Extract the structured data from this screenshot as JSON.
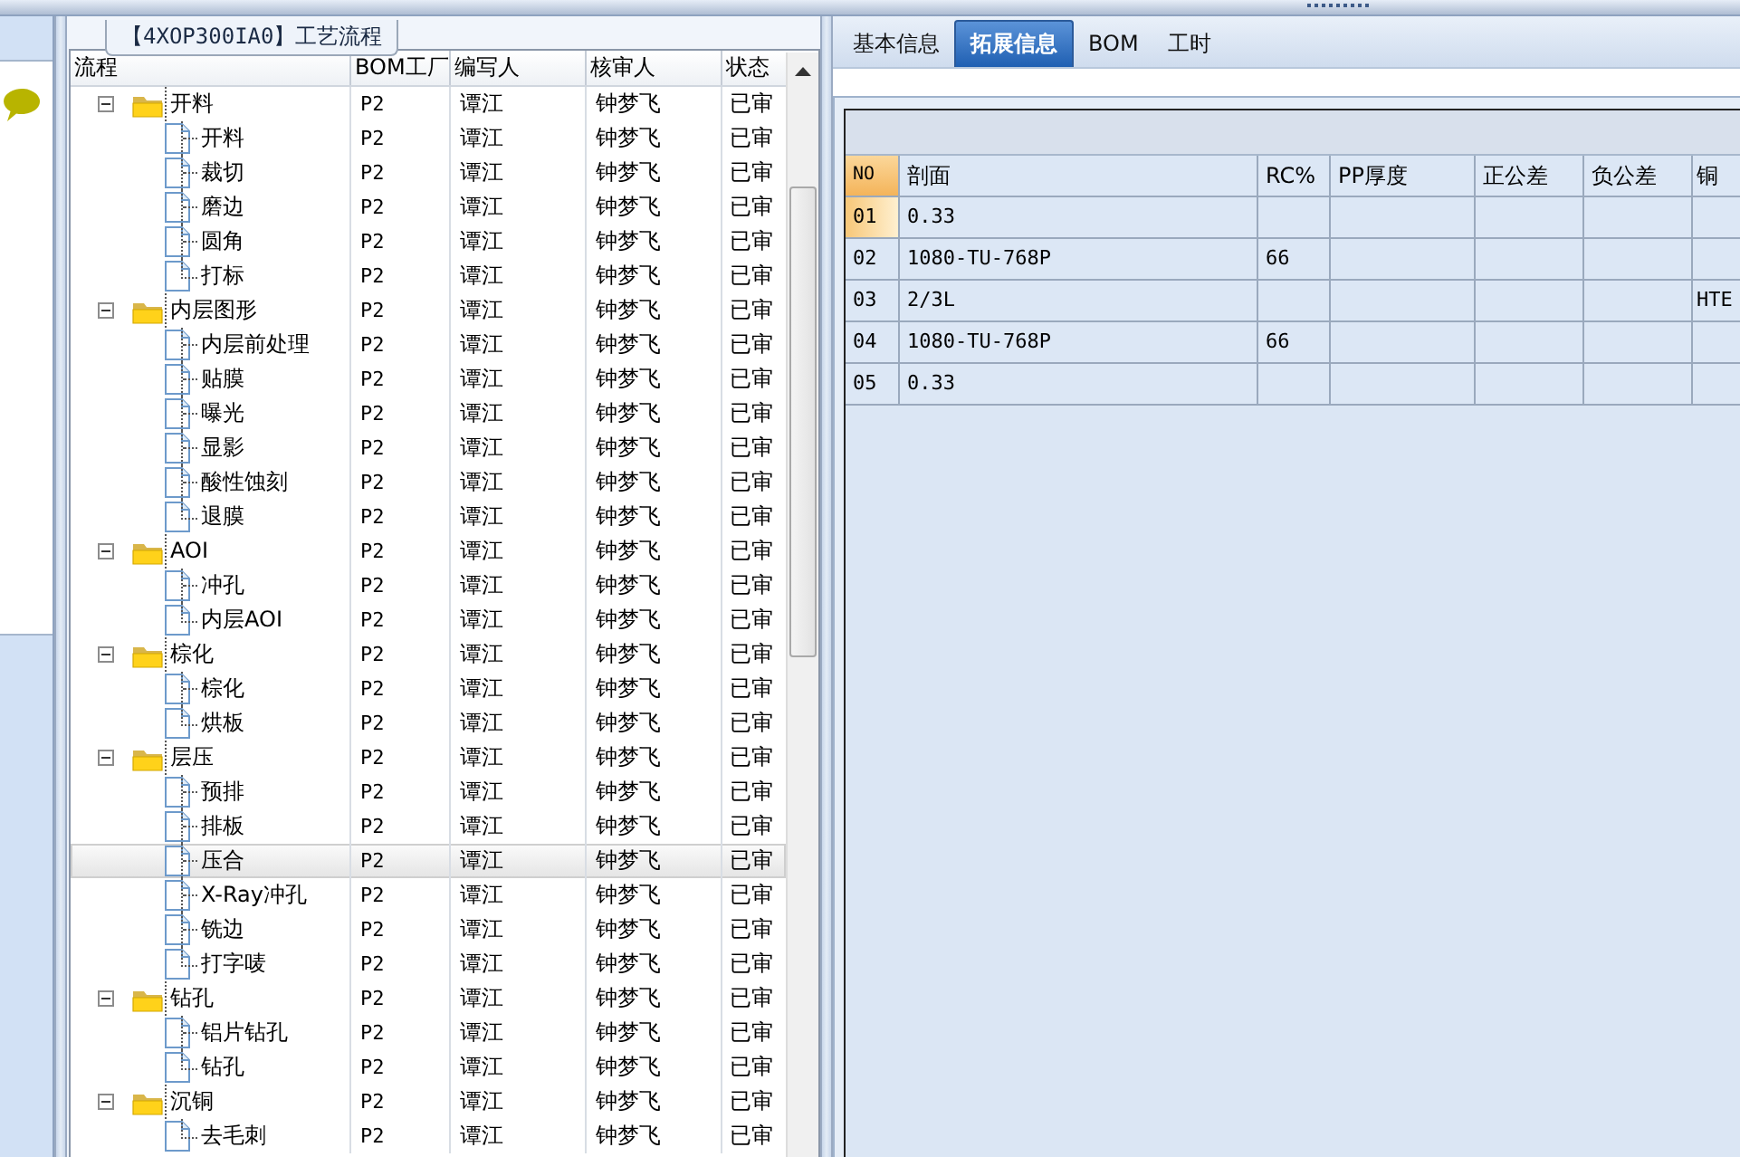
{
  "process_panel": {
    "title": "【4XOP300IA0】工艺流程",
    "columns": [
      "流程",
      "BOM工厂",
      "编写人",
      "核审人",
      "状态"
    ],
    "tree": [
      {
        "name": "开料",
        "bom": "P2",
        "writer": "谭江",
        "reviewer": "钟梦飞",
        "status": "已审",
        "expanded": true,
        "selected": false,
        "children": [
          {
            "name": "开料",
            "bom": "P2",
            "writer": "谭江",
            "reviewer": "钟梦飞",
            "status": "已审",
            "selected": false
          },
          {
            "name": "裁切",
            "bom": "P2",
            "writer": "谭江",
            "reviewer": "钟梦飞",
            "status": "已审",
            "selected": false
          },
          {
            "name": "磨边",
            "bom": "P2",
            "writer": "谭江",
            "reviewer": "钟梦飞",
            "status": "已审",
            "selected": false
          },
          {
            "name": "圆角",
            "bom": "P2",
            "writer": "谭江",
            "reviewer": "钟梦飞",
            "status": "已审",
            "selected": false
          },
          {
            "name": "打标",
            "bom": "P2",
            "writer": "谭江",
            "reviewer": "钟梦飞",
            "status": "已审",
            "selected": false
          }
        ]
      },
      {
        "name": "内层图形",
        "bom": "P2",
        "writer": "谭江",
        "reviewer": "钟梦飞",
        "status": "已审",
        "expanded": true,
        "selected": false,
        "children": [
          {
            "name": "内层前处理",
            "bom": "P2",
            "writer": "谭江",
            "reviewer": "钟梦飞",
            "status": "已审",
            "selected": false
          },
          {
            "name": "贴膜",
            "bom": "P2",
            "writer": "谭江",
            "reviewer": "钟梦飞",
            "status": "已审",
            "selected": false
          },
          {
            "name": "曝光",
            "bom": "P2",
            "writer": "谭江",
            "reviewer": "钟梦飞",
            "status": "已审",
            "selected": false
          },
          {
            "name": "显影",
            "bom": "P2",
            "writer": "谭江",
            "reviewer": "钟梦飞",
            "status": "已审",
            "selected": false
          },
          {
            "name": "酸性蚀刻",
            "bom": "P2",
            "writer": "谭江",
            "reviewer": "钟梦飞",
            "status": "已审",
            "selected": false
          },
          {
            "name": "退膜",
            "bom": "P2",
            "writer": "谭江",
            "reviewer": "钟梦飞",
            "status": "已审",
            "selected": false
          }
        ]
      },
      {
        "name": "AOI",
        "bom": "P2",
        "writer": "谭江",
        "reviewer": "钟梦飞",
        "status": "已审",
        "expanded": true,
        "selected": false,
        "children": [
          {
            "name": "冲孔",
            "bom": "P2",
            "writer": "谭江",
            "reviewer": "钟梦飞",
            "status": "已审",
            "selected": false
          },
          {
            "name": "内层AOI",
            "bom": "P2",
            "writer": "谭江",
            "reviewer": "钟梦飞",
            "status": "已审",
            "selected": false
          }
        ]
      },
      {
        "name": "棕化",
        "bom": "P2",
        "writer": "谭江",
        "reviewer": "钟梦飞",
        "status": "已审",
        "expanded": true,
        "selected": false,
        "children": [
          {
            "name": "棕化",
            "bom": "P2",
            "writer": "谭江",
            "reviewer": "钟梦飞",
            "status": "已审",
            "selected": false
          },
          {
            "name": "烘板",
            "bom": "P2",
            "writer": "谭江",
            "reviewer": "钟梦飞",
            "status": "已审",
            "selected": false
          }
        ]
      },
      {
        "name": "层压",
        "bom": "P2",
        "writer": "谭江",
        "reviewer": "钟梦飞",
        "status": "已审",
        "expanded": true,
        "selected": false,
        "children": [
          {
            "name": "预排",
            "bom": "P2",
            "writer": "谭江",
            "reviewer": "钟梦飞",
            "status": "已审",
            "selected": false
          },
          {
            "name": "排板",
            "bom": "P2",
            "writer": "谭江",
            "reviewer": "钟梦飞",
            "status": "已审",
            "selected": false
          },
          {
            "name": "压合",
            "bom": "P2",
            "writer": "谭江",
            "reviewer": "钟梦飞",
            "status": "已审",
            "selected": true
          },
          {
            "name": "X-Ray冲孔",
            "bom": "P2",
            "writer": "谭江",
            "reviewer": "钟梦飞",
            "status": "已审",
            "selected": false
          },
          {
            "name": "铣边",
            "bom": "P2",
            "writer": "谭江",
            "reviewer": "钟梦飞",
            "status": "已审",
            "selected": false
          },
          {
            "name": "打字唛",
            "bom": "P2",
            "writer": "谭江",
            "reviewer": "钟梦飞",
            "status": "已审",
            "selected": false
          }
        ]
      },
      {
        "name": "钻孔",
        "bom": "P2",
        "writer": "谭江",
        "reviewer": "钟梦飞",
        "status": "已审",
        "expanded": true,
        "selected": false,
        "children": [
          {
            "name": "铝片钻孔",
            "bom": "P2",
            "writer": "谭江",
            "reviewer": "钟梦飞",
            "status": "已审",
            "selected": false
          },
          {
            "name": "钻孔",
            "bom": "P2",
            "writer": "谭江",
            "reviewer": "钟梦飞",
            "status": "已审",
            "selected": false
          }
        ]
      },
      {
        "name": "沉铜",
        "bom": "P2",
        "writer": "谭江",
        "reviewer": "钟梦飞",
        "status": "已审",
        "expanded": true,
        "selected": false,
        "children": [
          {
            "name": "去毛刺",
            "bom": "P2",
            "writer": "谭江",
            "reviewer": "钟梦飞",
            "status": "已审",
            "selected": false
          }
        ]
      }
    ]
  },
  "tabs": [
    {
      "label": "基本信息",
      "selected": false
    },
    {
      "label": "拓展信息",
      "selected": true
    },
    {
      "label": "BOM",
      "selected": false
    },
    {
      "label": "工时",
      "selected": false
    }
  ],
  "stack_table": {
    "columns": [
      "NO",
      "剖面",
      "RC%",
      "PP厚度",
      "正公差",
      "负公差",
      "铜"
    ],
    "rows": [
      {
        "cells": [
          "01",
          "0.33",
          "",
          "",
          "",
          "",
          ""
        ],
        "selected": true
      },
      {
        "cells": [
          "02",
          "1080-TU-768P",
          "66",
          "",
          "",
          "",
          ""
        ],
        "selected": false
      },
      {
        "cells": [
          "03",
          "2/3L",
          "",
          "",
          "",
          "",
          "HTE"
        ],
        "selected": false
      },
      {
        "cells": [
          "04",
          "1080-TU-768P",
          "66",
          "",
          "",
          "",
          ""
        ],
        "selected": false
      },
      {
        "cells": [
          "05",
          "0.33",
          "",
          "",
          "",
          "",
          ""
        ],
        "selected": false
      }
    ]
  }
}
